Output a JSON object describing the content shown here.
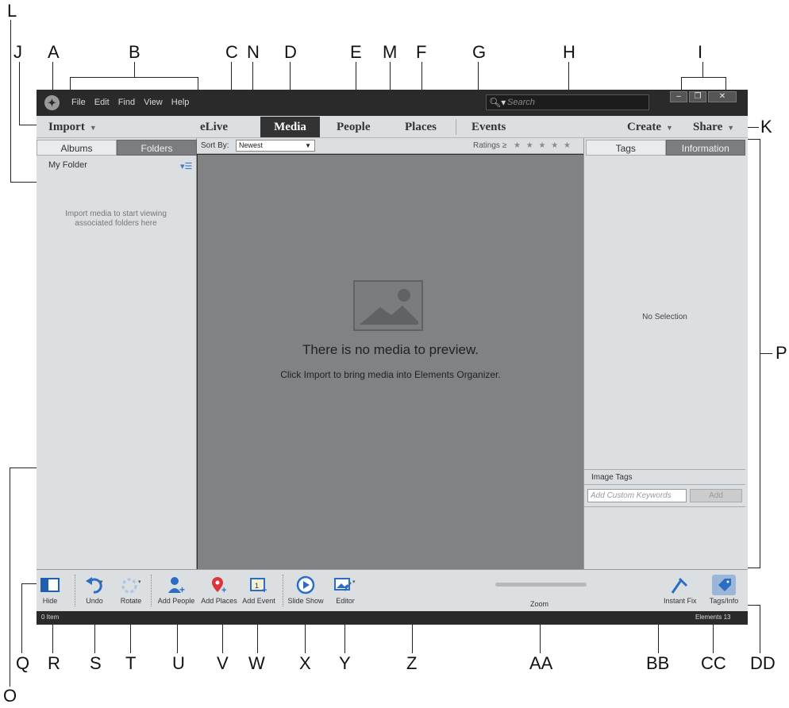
{
  "callouts": {
    "top": [
      "A",
      "B",
      "C",
      "D",
      "E",
      "F",
      "G",
      "H",
      "I",
      "J",
      "L",
      "M",
      "N"
    ],
    "A": "A",
    "B": "B",
    "C": "C",
    "D": "D",
    "E": "E",
    "F": "F",
    "G": "G",
    "H": "H",
    "I": "I",
    "J": "J",
    "K": "K",
    "L": "L",
    "M": "M",
    "N": "N",
    "O": "O",
    "P": "P",
    "Q": "Q",
    "R": "R",
    "S": "S",
    "T": "T",
    "U": "U",
    "V": "V",
    "W": "W",
    "X": "X",
    "Y": "Y",
    "Z": "Z",
    "AA": "AA",
    "BB": "BB",
    "CC": "CC",
    "DD": "DD"
  },
  "menu": {
    "file": "File",
    "edit": "Edit",
    "find": "Find",
    "view": "View",
    "help": "Help"
  },
  "search": {
    "placeholder": "Search"
  },
  "tabs": {
    "import": "Import",
    "elive": "eLive",
    "media": "Media",
    "people": "People",
    "places": "Places",
    "events": "Events",
    "create": "Create",
    "share": "Share"
  },
  "left_panel": {
    "albums_tab": "Albums",
    "folders_tab": "Folders",
    "my_folder": "My Folder",
    "message": "Import media to start viewing associated folders here"
  },
  "sort": {
    "label": "Sort By:",
    "selected": "Newest"
  },
  "ratings": {
    "label": "Ratings",
    "symbol": "≥",
    "stars": "★ ★ ★ ★ ★"
  },
  "preview": {
    "message": "There is no media to preview.",
    "submessage": "Click Import to bring media into Elements Organizer."
  },
  "right_panel": {
    "tags_tab": "Tags",
    "info_tab": "Information",
    "no_selection": "No Selection",
    "image_tags": "Image Tags",
    "keywords_placeholder": "Add Custom Keywords",
    "add_button": "Add"
  },
  "toolbar": {
    "hide": "Hide",
    "undo": "Undo",
    "rotate": "Rotate",
    "add_people": "Add People",
    "add_places": "Add Places",
    "add_event": "Add Event",
    "slide_show": "Slide Show",
    "editor": "Editor",
    "zoom": "Zoom",
    "instant_fix": "Instant Fix",
    "tags_info": "Tags/Info"
  },
  "status": {
    "items": "0 Item",
    "version": "Elements 13"
  },
  "colors": {
    "window_dark": "#2b2b2b",
    "panel": "#dcdfe2",
    "preview": "#808284",
    "accent_blue": "#3a78c8",
    "pin_red": "#d9363e"
  }
}
